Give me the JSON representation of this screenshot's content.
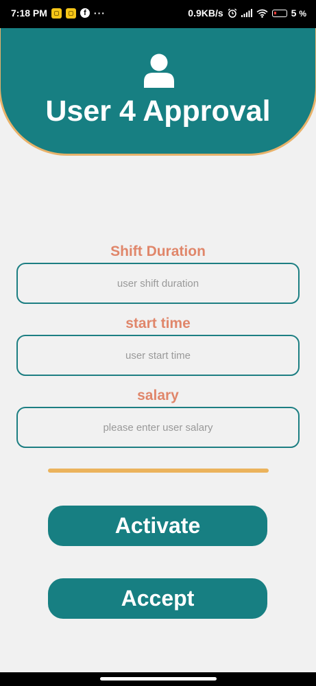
{
  "status_bar": {
    "time": "7:18 PM",
    "dots": "···",
    "speed": "0.9KB/s",
    "battery": "5",
    "battery_unit": "%",
    "icons": [
      "notification-app-icon",
      "notification-app-icon",
      "facebook-icon",
      "alarm-icon",
      "signal-icon",
      "wifi-icon",
      "battery-icon"
    ]
  },
  "header": {
    "icon": "user-icon",
    "title": "User 4 Approval"
  },
  "form": {
    "shift_label": "Shift Duration",
    "shift_placeholder": "user shift duration",
    "start_label": "start time",
    "start_placeholder": "user start time",
    "salary_label": "salary",
    "salary_placeholder": "please enter user salary"
  },
  "actions": {
    "activate": "Activate",
    "accept": "Accept"
  },
  "colors": {
    "primary": "#177f82",
    "label": "#e0866a",
    "accent": "#ebb35c",
    "header_border": "#e8b26a",
    "background": "#f1f1f1"
  }
}
